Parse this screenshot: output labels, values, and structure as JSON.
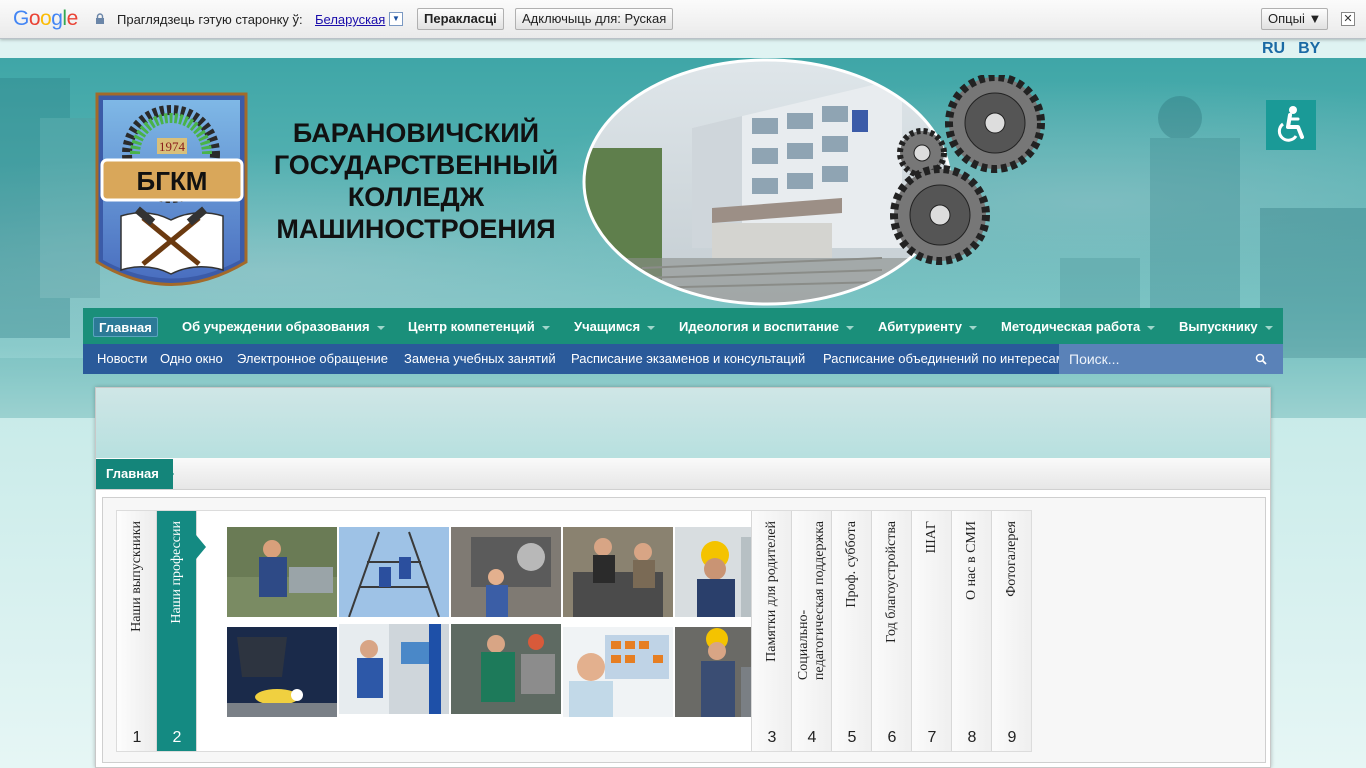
{
  "translate_bar": {
    "prompt": "Праглядзець гэтую старонку ў:",
    "language": "Беларуская",
    "translate_button": "Перакласці",
    "disable_button": "Адключыць для: Руская",
    "options_button": "Опцыі ▼",
    "close": "✕"
  },
  "lang_switch": {
    "ru": "RU",
    "by": "BY"
  },
  "header": {
    "emblem_year": "1974",
    "emblem_abbr": "БГКМ",
    "title_lines": [
      "БАРАНОВИЧСКИЙ",
      "ГОСУДАРСТВЕННЫЙ",
      "КОЛЛЕДЖ",
      "МАШИНОСТРОЕНИЯ"
    ]
  },
  "main_nav": [
    {
      "label": "Главная",
      "active": true
    },
    {
      "label": "Об учреждении образования",
      "has_dropdown": true
    },
    {
      "label": "Центр компетенций",
      "has_dropdown": true
    },
    {
      "label": "Учащимся",
      "has_dropdown": true
    },
    {
      "label": "Идеология и воспитание",
      "has_dropdown": true
    },
    {
      "label": "Абитуриенту",
      "has_dropdown": true
    },
    {
      "label": "Методическая работа",
      "has_dropdown": true
    },
    {
      "label": "Выпускнику",
      "has_dropdown": true
    }
  ],
  "sub_nav": [
    "Новости",
    "Одно окно",
    "Электронное обращение",
    "Замена учебных занятий",
    "Расписание экзаменов и консультаций",
    "Расписание объединений по интересам"
  ],
  "search": {
    "placeholder": "Поиск..."
  },
  "breadcrumb": {
    "home": "Главная"
  },
  "accordion": {
    "left_tabs": [
      {
        "label": "Наши выпускники",
        "num": "1"
      },
      {
        "label": "Наши профессии",
        "num": "2",
        "active": true
      }
    ],
    "right_tabs": [
      {
        "label": "Памятки для родителей",
        "num": "3"
      },
      {
        "label": "Социально-\nпедагогическая поддержка",
        "num": "4"
      },
      {
        "label": "Проф. суббота",
        "num": "5"
      },
      {
        "label": "Год благоустройства",
        "num": "6"
      },
      {
        "label": "ШАГ",
        "num": "7"
      },
      {
        "label": "О нас в СМИ",
        "num": "8"
      },
      {
        "label": "Фотогалерея",
        "num": "9"
      }
    ]
  },
  "colors": {
    "nav_green": "#1a8f7a",
    "subnav_blue": "#2a5a9a",
    "accent_teal": "#148a82",
    "lang_link": "#1b6aa5"
  }
}
